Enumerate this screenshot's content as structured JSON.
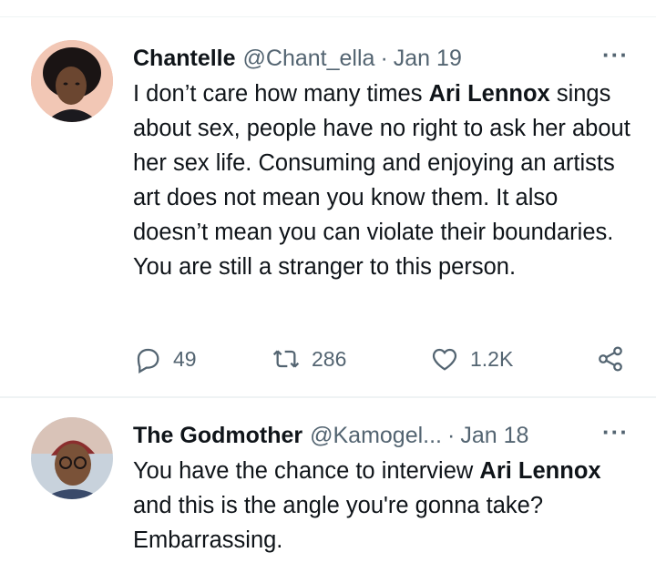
{
  "tweets": [
    {
      "author": "Chantelle",
      "handle": "@Chant_ella",
      "date": "Jan 19",
      "text_1": "I don’t care how many times ",
      "text_bold": "Ari Lennox",
      "text_2": " sings about sex, people have no right to ask her about her sex life. Consuming and enjoying an artists art does not mean you know them. It also doesn’t mean you can violate their boundaries. You are still a stranger to this person.",
      "replies": "49",
      "retweets": "286",
      "likes": "1.2K"
    },
    {
      "author": "The Godmother",
      "handle": "@Kamogel...",
      "date": "Jan 18",
      "text_1": "You have the chance to interview ",
      "text_bold": "Ari Lennox",
      "text_2": " and this is the angle you're gonna take? Embarrassing."
    }
  ],
  "separator": "·",
  "more_glyph": "···",
  "icons": [
    "reply-icon",
    "retweet-icon",
    "like-icon",
    "share-icon",
    "more-icon"
  ],
  "colors": {
    "text": "#0f1419",
    "secondary": "#536471",
    "divider": "#eff3f4"
  }
}
